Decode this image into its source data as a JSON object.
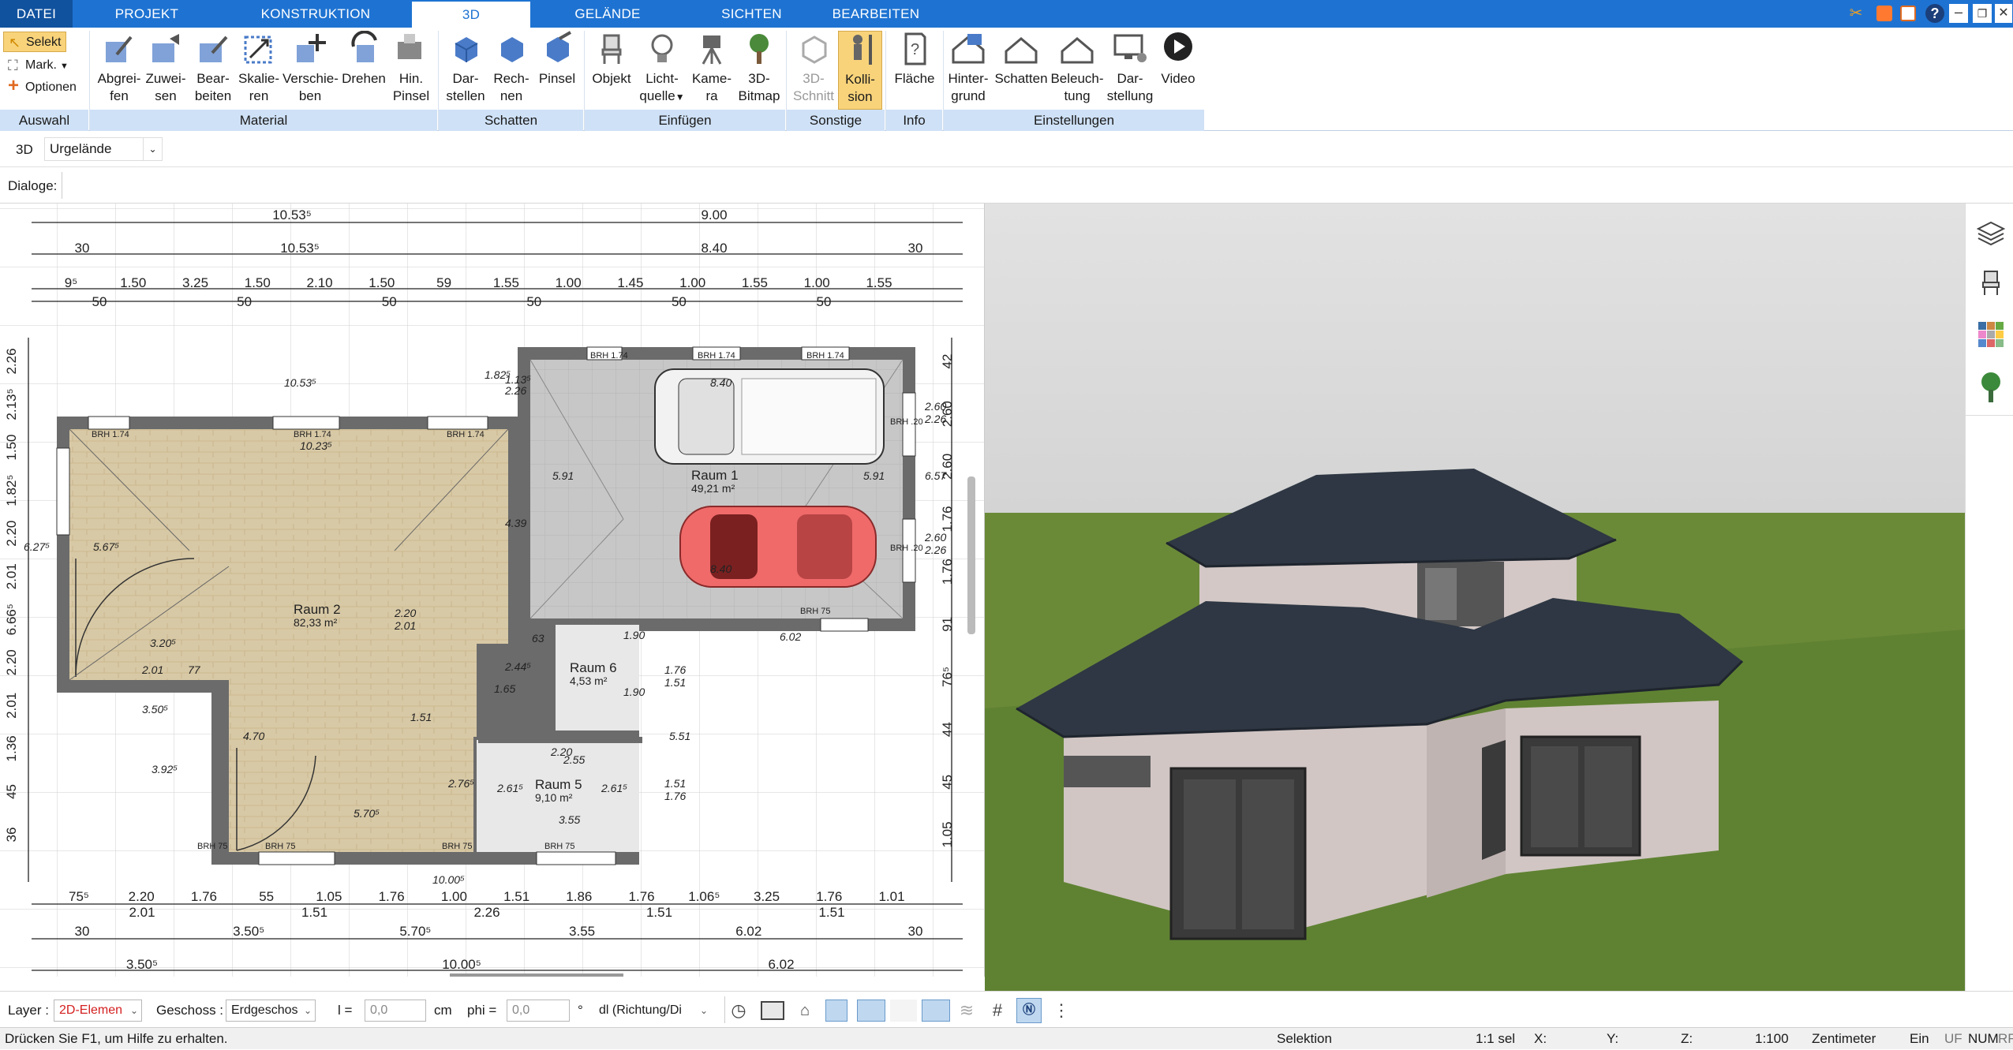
{
  "menu": {
    "tabs": [
      "DATEI",
      "PROJEKT",
      "KONSTRUKTION",
      "3D",
      "GELÄNDE",
      "SICHTEN",
      "BEARBEITEN"
    ]
  },
  "ribbon": {
    "selection": {
      "select": "Selekt",
      "mark": "Mark.",
      "options": "Optionen",
      "group": "Auswahl"
    },
    "material": {
      "group": "Material",
      "buttons": [
        [
          "Abgrei-",
          "fen"
        ],
        [
          "Zuwei-",
          "sen"
        ],
        [
          "Bear-",
          "beiten"
        ],
        [
          "Skalie-",
          "ren"
        ],
        [
          "Verschie-",
          "ben"
        ],
        [
          "Drehen",
          ""
        ],
        [
          "Hin.",
          "Pinsel"
        ]
      ]
    },
    "shadow": {
      "group": "Schatten",
      "buttons": [
        [
          "Dar-",
          "stellen"
        ],
        [
          "Rech-",
          "nen"
        ],
        [
          "Pinsel",
          ""
        ]
      ]
    },
    "insert": {
      "group": "Einfügen",
      "buttons": [
        [
          "Objekt",
          ""
        ],
        [
          "Licht-",
          "quelle"
        ],
        [
          "Kame-",
          "ra"
        ],
        [
          "3D-",
          "Bitmap"
        ]
      ]
    },
    "misc": {
      "group": "Sonstige",
      "buttons": [
        [
          "3D-",
          "Schnitt"
        ],
        [
          "Kolli-",
          "sion"
        ]
      ]
    },
    "info": {
      "group": "Info",
      "buttons": [
        [
          "Fläche",
          ""
        ]
      ]
    },
    "settings": {
      "group": "Einstellungen",
      "buttons": [
        [
          "Hinter-",
          "grund"
        ],
        [
          "Schatten",
          ""
        ],
        [
          "Beleuch-",
          "tung"
        ],
        [
          "Dar-",
          "stellung"
        ],
        [
          "Video",
          ""
        ]
      ]
    }
  },
  "toolbar2": {
    "mode": "3D",
    "terrain": "Urgelände"
  },
  "toolbar3": {
    "dialogs": "Dialoge:"
  },
  "plan": {
    "rooms": [
      {
        "name": "Raum 1",
        "area": "49,21 m²"
      },
      {
        "name": "Raum 2",
        "area": "82,33 m²"
      },
      {
        "name": "Raum 6",
        "area": "4,53 m²"
      },
      {
        "name": "Raum 5",
        "area": "9,10 m²"
      }
    ],
    "dims_top": [
      "10.53⁵",
      "9.00",
      "30",
      "10.53⁵",
      "8.40",
      "30"
    ],
    "dims_row3": [
      "9⁵",
      "1.50",
      "3.25",
      "1.50",
      "2.10",
      "1.50",
      "59",
      "1.55",
      "1.00",
      "1.45",
      "1.00",
      "1.55",
      "1.00",
      "1.55"
    ],
    "dims_row3b": [
      "50",
      "50",
      "50",
      "50",
      "50",
      "50"
    ],
    "dims_bottom1": [
      "75⁵",
      "2.20",
      "1.76",
      "55",
      "1.05",
      "1.76",
      "1.00",
      "1.51",
      "1.86",
      "1.76",
      "1.06⁵",
      "3.25",
      "1.76",
      "1.01"
    ],
    "dims_bottom1b": [
      "2.01",
      "1.51",
      "2.26",
      "1.51",
      "1.51"
    ],
    "dims_bottom2": [
      "30",
      "3.50⁵",
      "5.70⁵",
      "3.55",
      "6.02",
      "30"
    ],
    "dims_bottom3": [
      "3.50⁵",
      "10.00⁵",
      "6.02"
    ],
    "dims_left": [
      "2.26",
      "2.13⁵",
      "1.50",
      "1.82⁵",
      "2.20",
      "2.01",
      "6.66⁵",
      "2.20",
      "2.01",
      "1.36",
      "45",
      "36"
    ],
    "dims_right": [
      "42",
      "2.60",
      "2.60",
      "1.76",
      "1.76",
      "91",
      "76⁵",
      "44",
      "45",
      "1.05"
    ],
    "inner": [
      "10.53⁵",
      "10.23⁵",
      "10.00⁵",
      "5.91",
      "5.91",
      "4.39",
      "8.40",
      "8.40",
      "5.67⁵",
      "6.27⁵",
      "3.20⁵",
      "3.50⁵",
      "4.70",
      "3.92⁵",
      "5.70⁵",
      "2.76⁵",
      "2.61⁵",
      "2.61⁵",
      "2.44⁵",
      "1.65",
      "1.90",
      "1.90",
      "63",
      "2.20",
      "2.01",
      "2.20",
      "2.55",
      "3.55",
      "6.02",
      "6.57",
      "5.51",
      "1.76",
      "1.51",
      "1.51",
      "1.76",
      "77",
      "2.01",
      "1.51",
      "1.13⁵",
      "2.26",
      "1.82⁵",
      "2.60",
      "2.26",
      "2.60",
      "2.26"
    ],
    "brh": [
      "BRH 1.74",
      "BRH 1.74",
      "BRH 1.74",
      "BRH 1.74",
      "BRH 1.74",
      "BRH 1.74",
      "BRH 75",
      "BRH 75",
      "BRH 75",
      "BRH .20",
      "BRH .20",
      "BRH 75",
      "BRH 75"
    ]
  },
  "bottom": {
    "layer_label": "Layer :",
    "layer_value": "2D-Elemen",
    "floor_label": "Geschoss :",
    "floor_value": "Erdgeschos",
    "l_label": "l =",
    "l_value": "0,0",
    "l_unit": "cm",
    "phi_label": "phi =",
    "phi_value": "0,0",
    "phi_unit": "°",
    "dl_value": "dl (Richtung/Di"
  },
  "status": {
    "help": "Drücken Sie F1, um Hilfe zu erhalten.",
    "mode": "Selektion",
    "sel": "1:1 sel",
    "x": "X:",
    "y": "Y:",
    "z": "Z:",
    "scale": "1:100",
    "unit": "Zentimeter",
    "ein": "Ein",
    "uf": "UF",
    "num": "NUM",
    "rf": "RF"
  },
  "colors": {
    "accent": "#1e73d2",
    "ribbon_group": "#cfe1f6",
    "active_button": "#f8d37a",
    "grass": "#6f8f3a",
    "roof": "#2e3743",
    "wall": "#d1c6c4"
  }
}
